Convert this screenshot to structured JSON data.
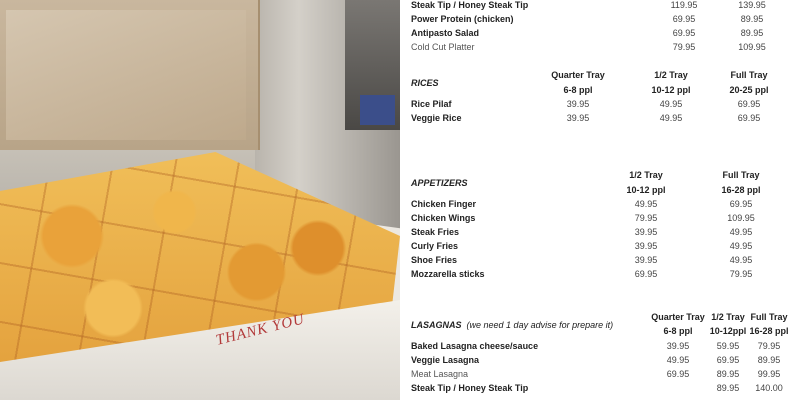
{
  "photo": {
    "box_text": "THANK YOU"
  },
  "top_rows": [
    {
      "name": "Steak Tip / Honey Steak Tip",
      "bold": true,
      "p1": "119.95",
      "p2": "139.95"
    },
    {
      "name": "Power Protein (chicken)",
      "bold": true,
      "p1": "69.95",
      "p2": "89.95"
    },
    {
      "name": "Antipasto Salad",
      "bold": true,
      "p1": "69.95",
      "p2": "89.95"
    },
    {
      "name": "Cold Cut Platter",
      "bold": false,
      "p1": "79.95",
      "p2": "109.95"
    }
  ],
  "rices": {
    "title": "RICES",
    "headers": [
      {
        "label": "Quarter Tray",
        "sub": "6-8 ppl"
      },
      {
        "label": "1/2 Tray",
        "sub": "10-12 ppl"
      },
      {
        "label": "Full Tray",
        "sub": "20-25 ppl"
      }
    ],
    "rows": [
      {
        "name": "Rice Pilaf",
        "prices": [
          "39.95",
          "49.95",
          "69.95"
        ]
      },
      {
        "name": "Veggie Rice",
        "prices": [
          "39.95",
          "49.95",
          "69.95"
        ]
      }
    ]
  },
  "appetizers": {
    "title": "APPETIZERS",
    "headers": [
      {
        "label": "1/2 Tray",
        "sub": "10-12 ppl"
      },
      {
        "label": "Full Tray",
        "sub": "16-28 ppl"
      }
    ],
    "rows": [
      {
        "name": "Chicken Finger",
        "prices": [
          "49.95",
          "69.95"
        ]
      },
      {
        "name": "Chicken Wings",
        "prices": [
          "79.95",
          "109.95"
        ]
      },
      {
        "name": "Steak Fries",
        "prices": [
          "39.95",
          "49.95"
        ]
      },
      {
        "name": "Curly Fries",
        "prices": [
          "39.95",
          "49.95"
        ]
      },
      {
        "name": "Shoe Fries",
        "prices": [
          "39.95",
          "49.95"
        ]
      },
      {
        "name": "Mozzarella sticks",
        "prices": [
          "69.95",
          "79.95"
        ]
      }
    ]
  },
  "lasagnas": {
    "title": "LASAGNAS",
    "note": "(we need 1 day advise for prepare it)",
    "headers": [
      {
        "label": "Quarter Tray",
        "sub": "6-8 ppl"
      },
      {
        "label": "1/2 Tray",
        "sub": "10-12ppl"
      },
      {
        "label": "Full Tray",
        "sub": "16-28 ppl"
      }
    ],
    "rows": [
      {
        "name": "Baked Lasagna cheese/sauce",
        "bold": true,
        "prices": [
          "39.95",
          "59.95",
          "79.95"
        ]
      },
      {
        "name": "Veggie Lasagna",
        "bold": true,
        "prices": [
          "49.95",
          "69.95",
          "89.95"
        ]
      },
      {
        "name": "Meat Lasagna",
        "bold": false,
        "prices": [
          "69.95",
          "89.95",
          "99.95"
        ]
      },
      {
        "name": "Steak Tip / Honey Steak Tip",
        "bold": true,
        "prices": [
          "",
          "89.95",
          "140.00"
        ]
      }
    ]
  }
}
